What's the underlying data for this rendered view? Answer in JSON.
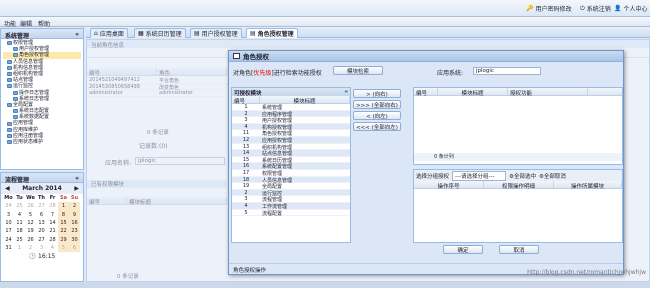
{
  "top": {
    "btn1": "用户密码修改",
    "btn2": "系统注销",
    "btn3": "个人中心"
  },
  "menu": [
    "功能",
    "编辑",
    "帮助"
  ],
  "sidebar": {
    "title": "系统管理",
    "items": [
      "权限管理",
      "用户授权管理",
      "角色授权管理",
      "人员信息管理",
      "机构信息管理",
      "组织机构管理",
      "站点管理",
      "运行监控",
      "操作日志管理",
      "系统日志管理",
      "全局配置",
      "系统日志配置",
      "系统数据配置",
      "应用管理",
      "应用库维护",
      "应用注册管理",
      "应用状态维护"
    ]
  },
  "flow": {
    "title": "流程管理"
  },
  "calendar": {
    "month": "March 2014",
    "days": [
      "Mo",
      "Tu",
      "We",
      "Th",
      "Fr",
      "Sa",
      "Su"
    ],
    "weeks": [
      [
        "24",
        "25",
        "26",
        "27",
        "28",
        "1",
        "2"
      ],
      [
        "3",
        "4",
        "5",
        "6",
        "7",
        "8",
        "9"
      ],
      [
        "10",
        "11",
        "12",
        "13",
        "14",
        "15",
        "16"
      ],
      [
        "17",
        "18",
        "19",
        "20",
        "21",
        "22",
        "23"
      ],
      [
        "24",
        "25",
        "26",
        "27",
        "28",
        "29",
        "30"
      ],
      [
        "31",
        "1",
        "2",
        "3",
        "4",
        "5",
        "6"
      ]
    ],
    "time": "16:15"
  },
  "tabs": [
    "应用桌面",
    "系统日历管理",
    "用户授权管理",
    "角色授权管理"
  ],
  "bg": {
    "section": "当前角色信息",
    "h1": "编号",
    "h2": "角色",
    "r1": [
      "2014521049497412",
      "平台角色"
    ],
    "r2": [
      "2014530850658498",
      "改变角色"
    ],
    "r3": [
      "administrator",
      "administrator"
    ],
    "count": "0 条记录",
    "rec": "记录数:(0)",
    "app_label": "应用名称:",
    "app_val": "jplogic",
    "s2": "已有权限模块",
    "h3": "编号",
    "h4": "模块标题",
    "foot": "0 条记录"
  },
  "dialog": {
    "title": "角色授权",
    "prompt_pre": "对角色[",
    "role": "优先级",
    "prompt_post": "]进行检索功能授权",
    "search_btn": "模块检索",
    "app_label": "应用系统:",
    "app_val": "jplogic",
    "left_title": "可授权模块",
    "lh1": "编号",
    "lh2": "模块标题",
    "left_rows": [
      [
        "1",
        "系统管理"
      ],
      [
        "2",
        "应用程序管理"
      ],
      [
        "3",
        "用户授权管理"
      ],
      [
        "4",
        "机构授权管理"
      ],
      [
        "11",
        "角色授权管理"
      ],
      [
        "12",
        "应用授权管理"
      ],
      [
        "13",
        "组织机构管理"
      ],
      [
        "14",
        "站点信息管理"
      ],
      [
        "15",
        "系统日历管理"
      ],
      [
        "16",
        "系统配置管理"
      ],
      [
        "17",
        "权限管理"
      ],
      [
        "18",
        "人员信息管理"
      ],
      [
        "19",
        "全局配置"
      ],
      [
        "2",
        "运行监控"
      ],
      [
        "3",
        "流程管理"
      ],
      [
        "4",
        "工作流管理"
      ],
      [
        "5",
        "流程配置"
      ]
    ],
    "btn_r1": "> (向右)",
    "btn_r2": ">>> (全部向右)",
    "btn_l1": "< (向左)",
    "btn_l2": "<<< (全部向左)",
    "rh1": "编号",
    "rh2": "模块标题",
    "rh3": "授权功能",
    "rfoot": "0 条计列",
    "sel_label": "选择分组授权",
    "sel_val": "---请选择分组---",
    "sel_all": "全部选中",
    "cancel_all": "全部取消",
    "gh1": "操作序号",
    "gh2": "权限操作明细",
    "gh3": "操作所属模块",
    "ok": "确定",
    "cancel": "取消",
    "foot": "角色授权操作"
  },
  "watermark": "http://blog.csdn.net/romantichjwhjwhjw"
}
